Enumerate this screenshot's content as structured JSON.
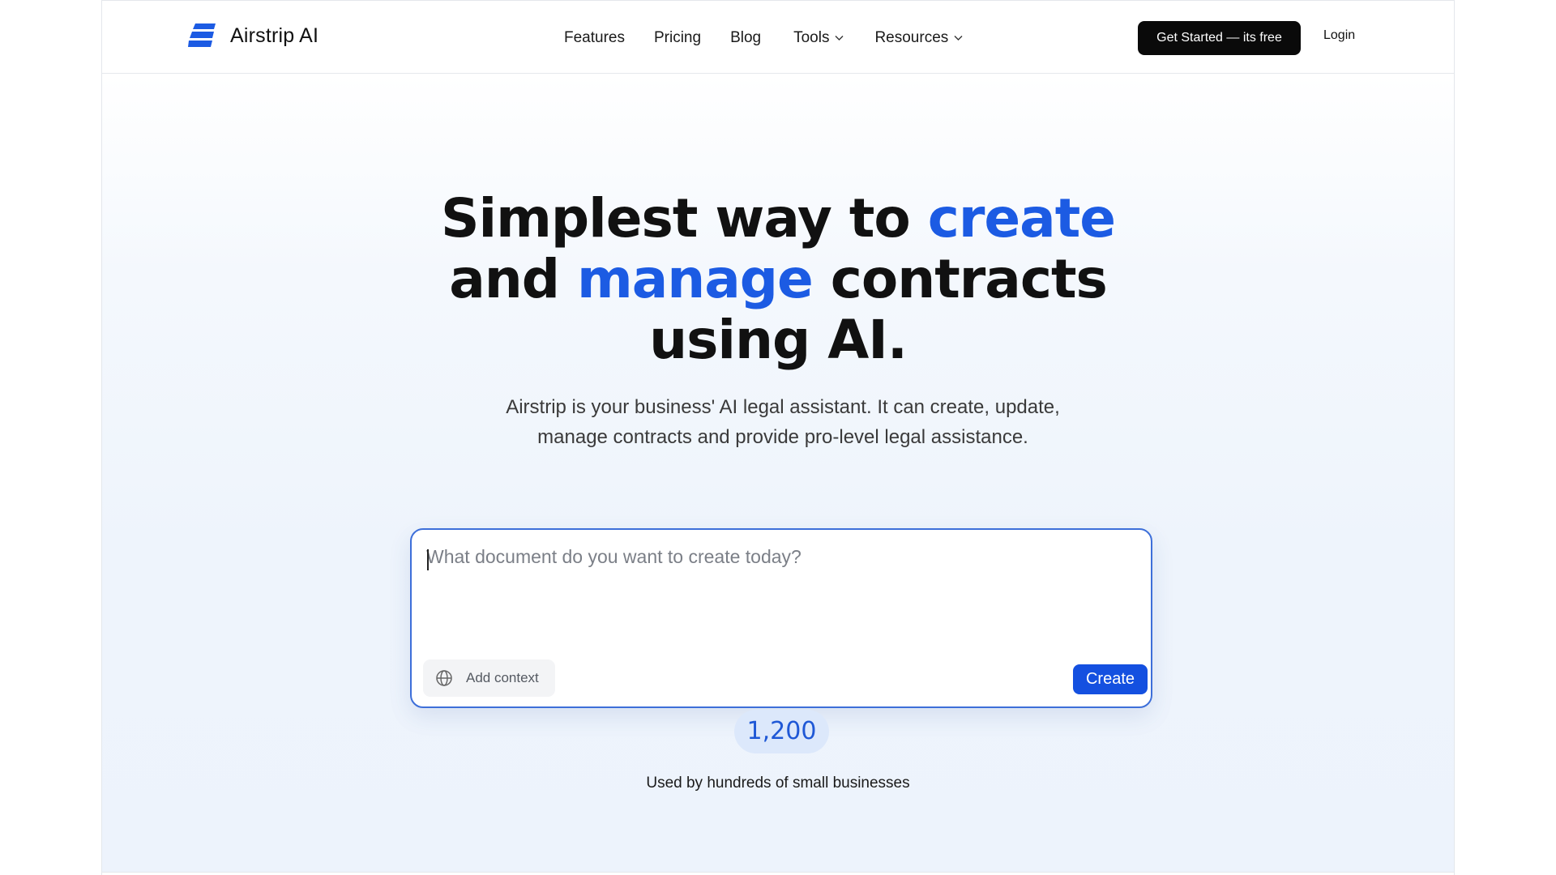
{
  "brand": {
    "name": "Airstrip AI",
    "logo_icon": "airstrip-stripes-icon",
    "accent": "#1c5be3"
  },
  "nav": {
    "items": [
      {
        "label": "Features",
        "has_dropdown": false
      },
      {
        "label": "Pricing",
        "has_dropdown": false
      },
      {
        "label": "Blog",
        "has_dropdown": false
      },
      {
        "label": "Tools",
        "has_dropdown": true
      },
      {
        "label": "Resources",
        "has_dropdown": true
      }
    ],
    "cta_label": "Get Started — its free",
    "login_label": "Login"
  },
  "hero": {
    "headline": {
      "line1_start": "Simplest way to ",
      "line1_accent": "create",
      "line2_start": "and ",
      "line2_accent": "manage",
      "line2_end": " contracts",
      "line3": "using AI."
    },
    "subtitle": "Airstrip is your business' AI legal assistant. It can create, update, manage contracts and provide pro-level legal assistance."
  },
  "composer": {
    "placeholder": "What document do you want to create today?",
    "value": "",
    "add_context_label": "Add context",
    "add_context_icon": "globe-icon",
    "create_label": "Create"
  },
  "stats": {
    "count": "1,200",
    "caption": "Used by hundreds of small businesses"
  }
}
